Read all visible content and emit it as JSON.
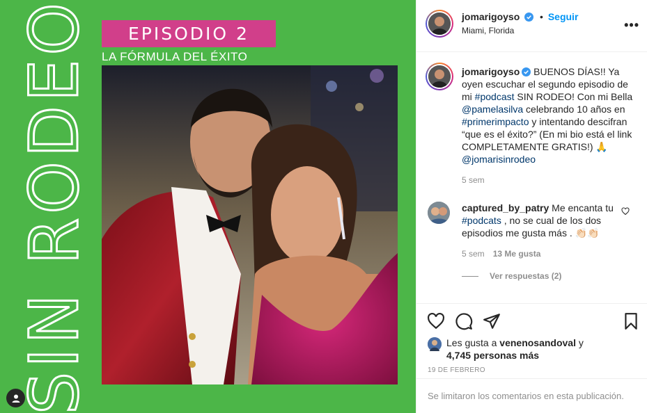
{
  "post_image": {
    "vertical_title": "SIN RODEO",
    "episode_label": "EPISODIO 2",
    "episode_subtitle": "LA FÓRMULA DEL ÉXITO"
  },
  "header": {
    "username": "jomarigoyso",
    "separator": "•",
    "follow_label": "Seguir",
    "location": "Miami, Florida",
    "more_label": "•••"
  },
  "caption": {
    "username": "jomarigoyso",
    "text_1": " BUENOS DÍAS!! Ya oyen escuchar el segundo episodio de mi ",
    "hashtag_podcast": "#podcast",
    "text_2": " SIN RODEO! Con mi Bella ",
    "mention_pamela": "@pamelasilva",
    "text_3": " celebrando 10 años en ",
    "hashtag_primer": "#primerimpacto",
    "text_4": " y intentando descifran “que es el éxito?” (En mi bio está el link COMPLETAMENTE GRATIS!) 🙏 ",
    "mention_sinrodeo": "@jomarisinrodeo",
    "time": "5 sem"
  },
  "comment": {
    "username": "captured_by_patry",
    "text_1": " Me encanta tu ",
    "hashtag": "#podcats",
    "text_2": " , no se cual de los dos episodios me gusta más . 👏🏻👏🏻",
    "time": "5 sem",
    "likes": "13 Me gusta",
    "replies_label": "Ver respuestas (2)"
  },
  "likes": {
    "prefix": "Les gusta a ",
    "user": "venenosandoval",
    "middle": " y ",
    "count": "4,745 personas más"
  },
  "date": "19 DE FEBRERO",
  "footer": {
    "comments_disabled": "Se limitaron los comentarios en esta publicación."
  },
  "colors": {
    "background_green": "#4cb648",
    "banner_pink": "#d13f8a",
    "follow_blue": "#0095f6",
    "link_blue": "#00376b",
    "muted": "#8e8e8e"
  }
}
